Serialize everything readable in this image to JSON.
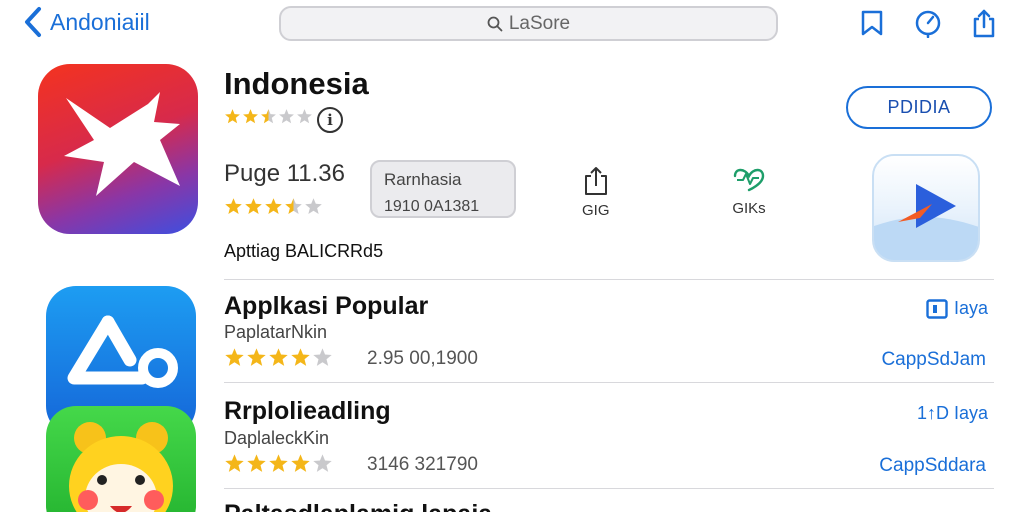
{
  "nav": {
    "back_label": "Andoniaiil",
    "search_text": "LaSore",
    "icons": [
      "bookmark-icon",
      "compass-icon",
      "share-icon"
    ]
  },
  "featured": {
    "title": "Indonesia",
    "star_rating": 2.5,
    "get_label": "PDIDIA",
    "price_label": "Puge 11.36",
    "rating_stars": 3.5,
    "age_box": {
      "line1": "Rarnhasia",
      "line2": "1910 0A1381"
    },
    "stat1": "GIG",
    "stat2": "GIKs",
    "section_label": "Apttiag BALICRRd5"
  },
  "apps": [
    {
      "name": "Applkasi Popular",
      "developer": "PaplatarNkin",
      "stars": 4,
      "rating_count": "2.95 00,1900",
      "size_label": "Iaya",
      "action_label": "CappSdJam",
      "icon_name": "app-triangle-icon"
    },
    {
      "name": "Rrplolieadling",
      "developer": "DaplaleckKin",
      "stars": 4,
      "rating_count": "3146 321790",
      "size_label": "1↑D Iaya",
      "action_label": "CappSddara",
      "icon_name": "app-bear-icon"
    }
  ],
  "cut_off_title": "Paltasdlaplamig lapaia",
  "colors": {
    "accent": "#1a6fd8",
    "star": "#f4b619",
    "star_empty": "#c9c9cc"
  }
}
